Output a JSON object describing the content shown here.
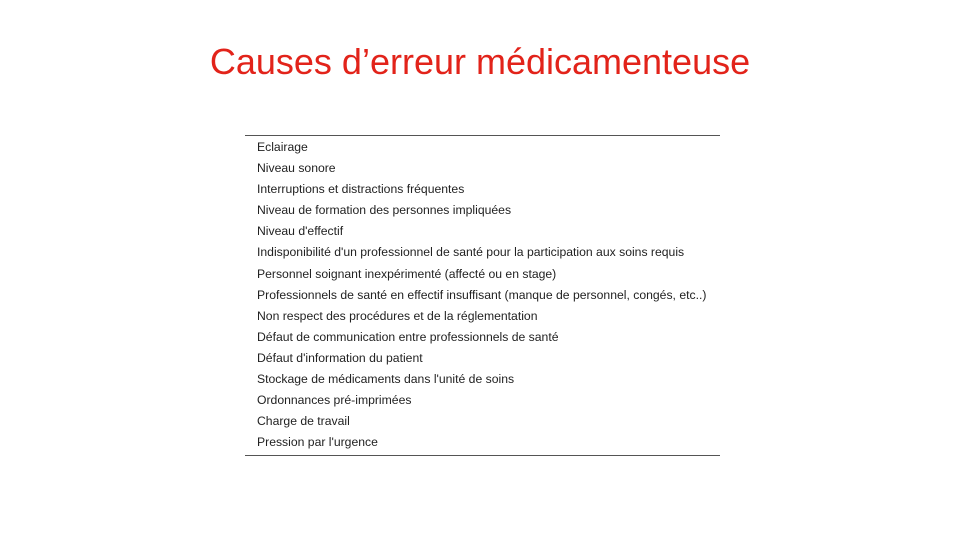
{
  "title": "Causes d’erreur médicamenteuse",
  "title_color": "#e2231a",
  "items": [
    "Eclairage",
    "Niveau sonore",
    "Interruptions et distractions fréquentes",
    "Niveau de formation des personnes impliquées",
    "Niveau d'effectif",
    "Indisponibilité d'un professionnel de santé pour la participation aux soins requis",
    "Personnel soignant inexpérimenté (affecté ou en stage)",
    "Professionnels de santé en effectif insuffisant (manque de personnel, congés, etc..)",
    "Non respect des procédures et de la réglementation",
    "Défaut de communication entre professionnels de santé",
    "Défaut d'information du patient",
    "Stockage de médicaments dans l'unité de soins",
    "Ordonnances pré-imprimées",
    "Charge de travail",
    "Pression par l'urgence"
  ]
}
